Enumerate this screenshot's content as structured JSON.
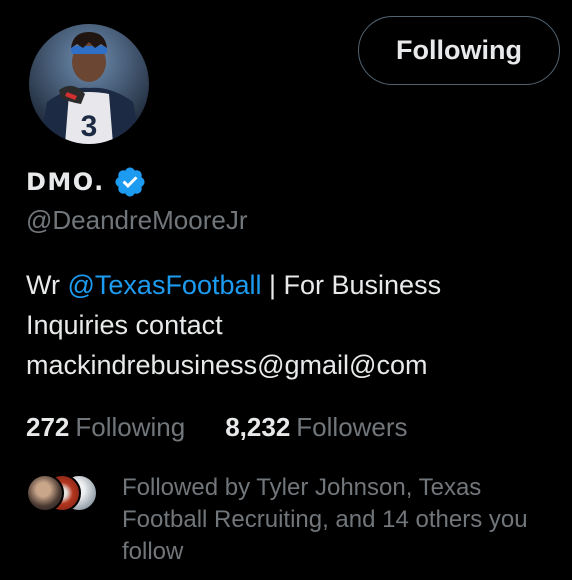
{
  "profile": {
    "display_name": "DMO.",
    "handle": "@DeandreMooreJr",
    "verified": true,
    "avatar_icon": "profile-photo",
    "follow_button_label": "Following"
  },
  "bio": {
    "prefix": "Wr ",
    "mention": "@TexasFootball",
    "suffix_line1": " | For Business",
    "line2": "Inquiries contact",
    "line3": "mackindrebusiness@gmail@com"
  },
  "stats": {
    "following_count": "272",
    "following_label": "Following",
    "followers_count": "8,232",
    "followers_label": "Followers"
  },
  "followed_by": {
    "text": "Followed by Tyler Johnson, Texas Football Recruiting, and 14 others you follow"
  },
  "colors": {
    "background": "#000000",
    "text_primary": "#e7e9ea",
    "text_secondary": "#71767b",
    "accent": "#1d9bf0",
    "border": "#536471"
  }
}
